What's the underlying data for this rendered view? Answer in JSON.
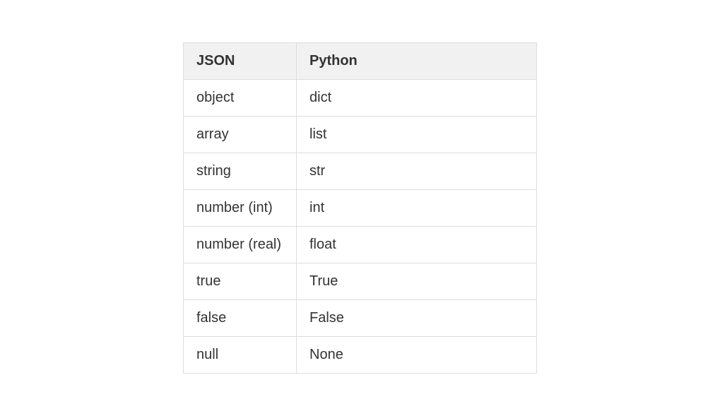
{
  "table": {
    "headers": {
      "json": "JSON",
      "python": "Python"
    },
    "rows": [
      {
        "json": "object",
        "python": "dict"
      },
      {
        "json": "array",
        "python": "list"
      },
      {
        "json": "string",
        "python": "str"
      },
      {
        "json": "number (int)",
        "python": "int"
      },
      {
        "json": "number (real)",
        "python": "float"
      },
      {
        "json": "true",
        "python": "True"
      },
      {
        "json": "false",
        "python": "False"
      },
      {
        "json": "null",
        "python": "None"
      }
    ]
  }
}
